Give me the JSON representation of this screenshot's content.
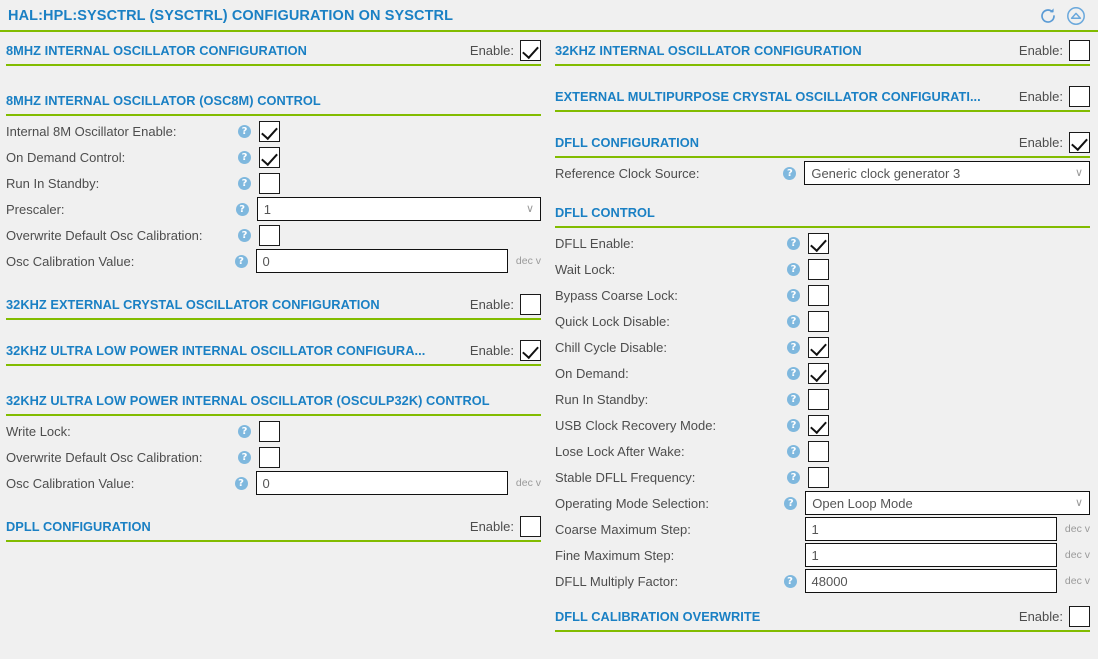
{
  "header": {
    "title": "HAL:HPL:SYSCTRL (SYSCTRL) CONFIGURATION ON SYSCTRL",
    "refresh_icon": "refresh-icon",
    "collapse_icon": "collapse-icon"
  },
  "labels": {
    "enable": "Enable:",
    "dec_value": "dec v",
    "help": "?",
    "chevron": "∨"
  },
  "colors": {
    "accent_blue": "#1a80c4",
    "rule_green": "#82bc00",
    "background": "#f0f0f0",
    "label_gray": "#4d4d4d",
    "help_blue": "#7fb8de"
  },
  "left_column": {
    "sections": [
      {
        "id": "osc8m-config",
        "title": "8MHZ INTERNAL OSCILLATOR CONFIGURATION",
        "has_enable": true,
        "enabled": true
      },
      {
        "id": "osc8m-control",
        "title": "8MHZ INTERNAL OSCILLATOR (OSC8M) CONTROL",
        "has_enable": false,
        "fields": [
          {
            "label": "Internal 8M Oscillator Enable:",
            "type": "checkbox",
            "checked": true,
            "help": true
          },
          {
            "label": "On Demand Control:",
            "type": "checkbox",
            "checked": true,
            "help": true
          },
          {
            "label": "Run In Standby:",
            "type": "checkbox",
            "checked": false,
            "help": true
          },
          {
            "label": "Prescaler:",
            "type": "select",
            "value": "1",
            "help": true
          },
          {
            "label": "Overwrite Default Osc Calibration:",
            "type": "checkbox",
            "checked": false,
            "help": true
          },
          {
            "label": "Osc Calibration Value:",
            "type": "text",
            "value": "0",
            "help": true,
            "unit": "dec v"
          }
        ]
      },
      {
        "id": "xosc32k-config",
        "title": "32KHZ EXTERNAL CRYSTAL OSCILLATOR CONFIGURATION",
        "has_enable": true,
        "enabled": false
      },
      {
        "id": "osculp32k-config",
        "title": "32KHZ ULTRA LOW POWER INTERNAL OSCILLATOR CONFIGURA...",
        "has_enable": true,
        "enabled": true
      },
      {
        "id": "osculp32k-control",
        "title": "32KHZ ULTRA LOW POWER INTERNAL OSCILLATOR (OSCULP32K) CONTROL",
        "has_enable": false,
        "fields": [
          {
            "label": "Write Lock:",
            "type": "checkbox",
            "checked": false,
            "help": true
          },
          {
            "label": "Overwrite Default Osc Calibration:",
            "type": "checkbox",
            "checked": false,
            "help": true
          },
          {
            "label": "Osc Calibration Value:",
            "type": "text",
            "value": "0",
            "help": true,
            "unit": "dec v"
          }
        ]
      },
      {
        "id": "dpll-config",
        "title": "DPLL CONFIGURATION",
        "has_enable": true,
        "enabled": false
      }
    ]
  },
  "right_column": {
    "sections": [
      {
        "id": "osc32k-config",
        "title": "32KHZ INTERNAL OSCILLATOR CONFIGURATION",
        "has_enable": true,
        "enabled": false
      },
      {
        "id": "xosc-config",
        "title": "EXTERNAL MULTIPURPOSE CRYSTAL OSCILLATOR CONFIGURATI...",
        "has_enable": true,
        "enabled": false
      },
      {
        "id": "dfll-config",
        "title": "DFLL CONFIGURATION",
        "has_enable": true,
        "enabled": true,
        "fields": [
          {
            "label": "Reference Clock Source:",
            "type": "select",
            "value": "Generic clock generator 3",
            "help": true
          }
        ]
      },
      {
        "id": "dfll-control",
        "title": "DFLL CONTROL",
        "has_enable": false,
        "fields": [
          {
            "label": "DFLL Enable:",
            "type": "checkbox",
            "checked": true,
            "help": true
          },
          {
            "label": "Wait Lock:",
            "type": "checkbox",
            "checked": false,
            "help": true
          },
          {
            "label": "Bypass Coarse Lock:",
            "type": "checkbox",
            "checked": false,
            "help": true
          },
          {
            "label": "Quick Lock Disable:",
            "type": "checkbox",
            "checked": false,
            "help": true
          },
          {
            "label": "Chill Cycle Disable:",
            "type": "checkbox",
            "checked": true,
            "help": true
          },
          {
            "label": "On Demand:",
            "type": "checkbox",
            "checked": true,
            "help": true
          },
          {
            "label": "Run In Standby:",
            "type": "checkbox",
            "checked": false,
            "help": true
          },
          {
            "label": "USB Clock Recovery Mode:",
            "type": "checkbox",
            "checked": true,
            "help": true
          },
          {
            "label": "Lose Lock After Wake:",
            "type": "checkbox",
            "checked": false,
            "help": true
          },
          {
            "label": "Stable DFLL Frequency:",
            "type": "checkbox",
            "checked": false,
            "help": true
          },
          {
            "label": "Operating Mode Selection:",
            "type": "select",
            "value": "Open Loop Mode",
            "help": true
          },
          {
            "label": "Coarse Maximum Step:",
            "type": "text",
            "value": "1",
            "help": false,
            "unit": "dec v"
          },
          {
            "label": "Fine Maximum Step:",
            "type": "text",
            "value": "1",
            "help": false,
            "unit": "dec v"
          },
          {
            "label": "DFLL Multiply Factor:",
            "type": "text",
            "value": "48000",
            "help": true,
            "unit": "dec v"
          }
        ]
      },
      {
        "id": "dfll-calibration-overwrite",
        "title": "DFLL CALIBRATION OVERWRITE",
        "has_enable": true,
        "enabled": false
      }
    ]
  }
}
